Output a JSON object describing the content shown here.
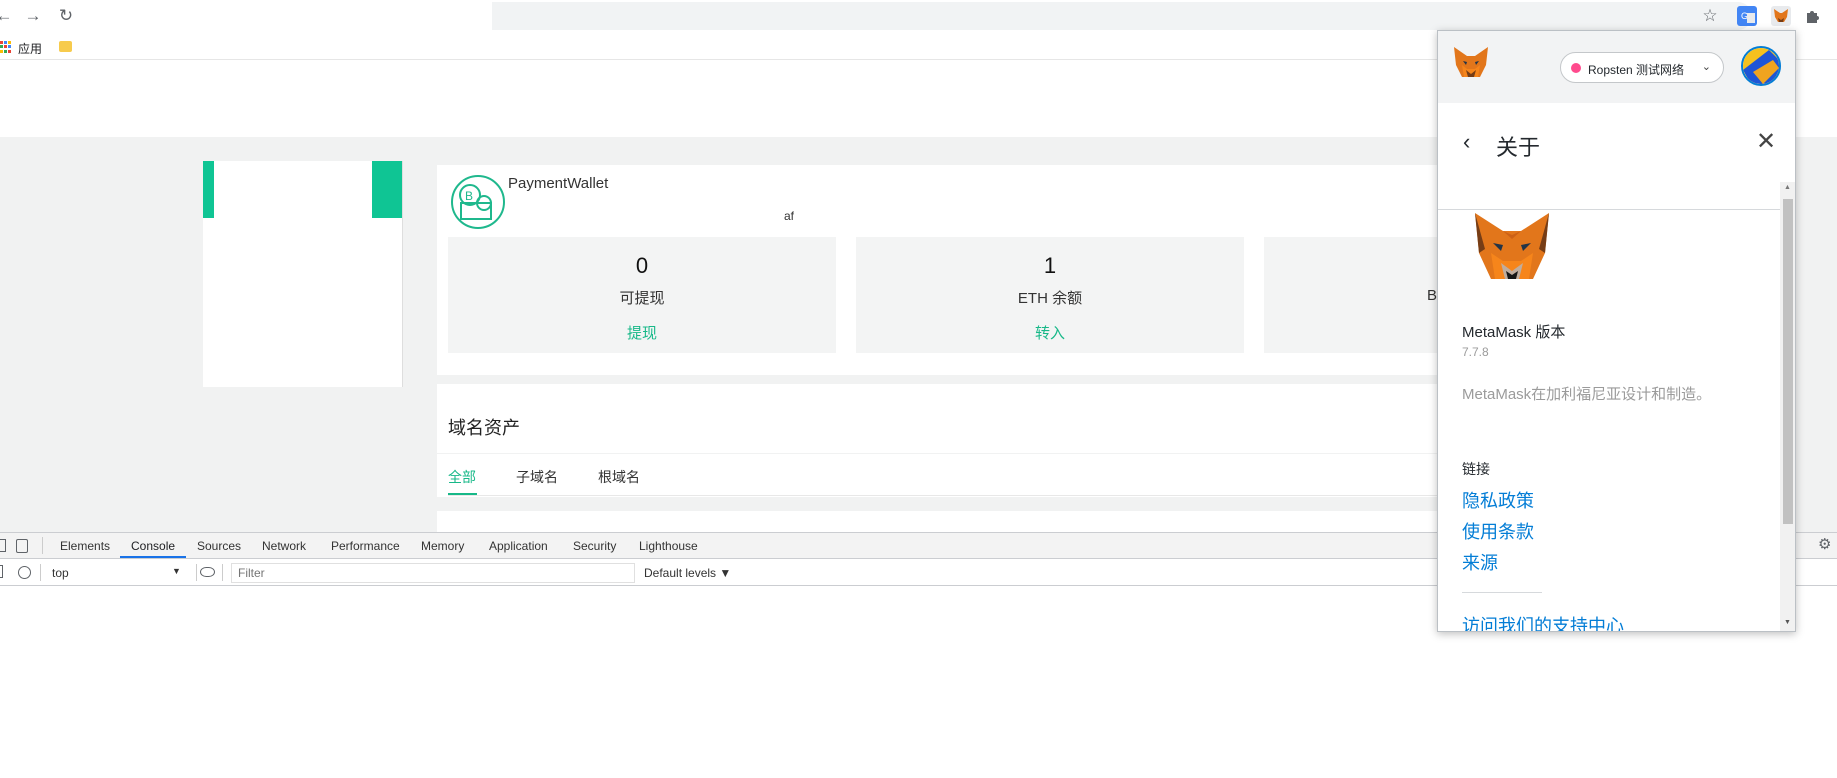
{
  "browser": {
    "back_icon": "arrow-left-icon",
    "forward_icon": "arrow-right-icon",
    "reload_icon": "reload-icon",
    "bookmark_star_icon": "star-icon",
    "extensions": [
      "translate-icon",
      "metamask-fox-icon",
      "puzzle-icon"
    ],
    "bookmarks": {
      "apps_label": "应用"
    }
  },
  "wallet": {
    "name": "PaymentWallet",
    "subtitle": "af",
    "stats": [
      {
        "value": "0",
        "label": "可提现",
        "action": "提现"
      },
      {
        "value": "1",
        "label": "ETH 余额",
        "action": "转入"
      },
      {
        "value": "",
        "label": "BA",
        "action": ""
      }
    ]
  },
  "assets": {
    "title": "域名资产",
    "tabs": [
      "全部",
      "子域名",
      "根域名"
    ],
    "active_tab": "全部"
  },
  "devtools": {
    "tabs": [
      "Elements",
      "Console",
      "Sources",
      "Network",
      "Performance",
      "Memory",
      "Application",
      "Security",
      "Lighthouse"
    ],
    "active_tab": "Console",
    "context": "top",
    "filter_placeholder": "Filter",
    "levels": "Default levels ▼"
  },
  "metamask": {
    "network": "Ropsten 测试网络",
    "network_color": "#ff4a8d",
    "page_title": "关于",
    "version_label": "MetaMask 版本",
    "version": "7.7.8",
    "made_in": "MetaMask在加利福尼亚设计和制造。",
    "links_label": "链接",
    "links": [
      "隐私政策",
      "使用条款",
      "来源",
      "访问我们的支持中心"
    ],
    "link_color": "#037dd6"
  },
  "colors": {
    "accent_green": "#17b888",
    "devtools_active": "#1a73e8"
  }
}
